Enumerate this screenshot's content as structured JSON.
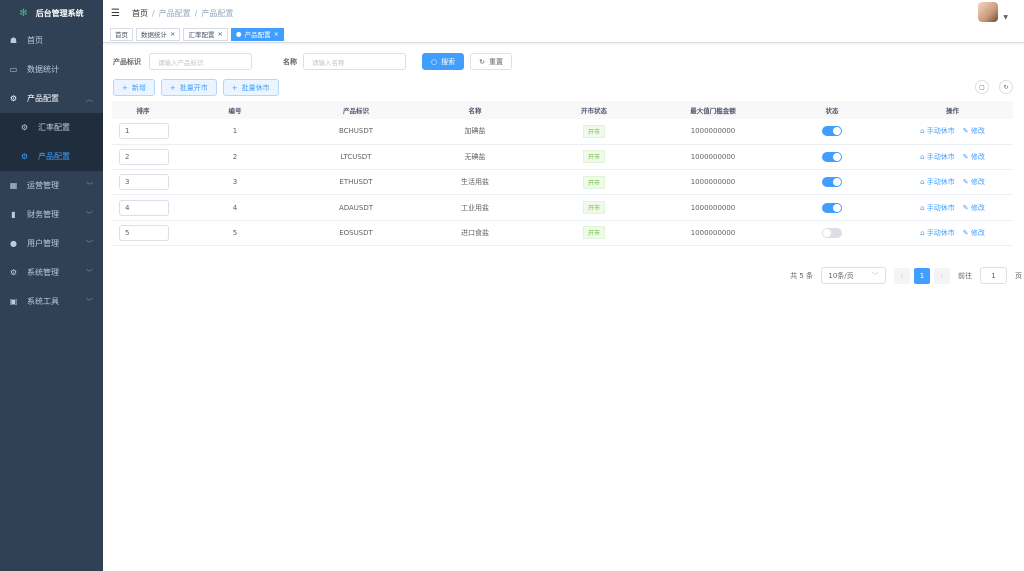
{
  "app": {
    "title": "后台管理系统"
  },
  "sidebar": {
    "items": [
      {
        "label": "首页",
        "icon": "dashboard-icon"
      },
      {
        "label": "数据统计",
        "icon": "monitor-icon"
      },
      {
        "label": "产品配置",
        "icon": "gear-icon",
        "expanded": true,
        "children": [
          {
            "label": "汇率配置"
          },
          {
            "label": "产品配置",
            "active": true
          }
        ]
      },
      {
        "label": "运营管理",
        "icon": "grid-icon"
      },
      {
        "label": "财务管理",
        "icon": "book-icon"
      },
      {
        "label": "用户管理",
        "icon": "user-icon"
      },
      {
        "label": "系统管理",
        "icon": "gear-icon"
      },
      {
        "label": "系统工具",
        "icon": "toolbox-icon"
      }
    ]
  },
  "breadcrumb": [
    "首页",
    "产品配置",
    "产品配置"
  ],
  "tags": [
    {
      "label": "首页"
    },
    {
      "label": "数据统计"
    },
    {
      "label": "汇率配置"
    },
    {
      "label": "产品配置",
      "active": true
    }
  ],
  "search": {
    "product_label": "产品标识",
    "product_placeholder": "请输入产品标识",
    "name_label": "名称",
    "name_placeholder": "请输入名称",
    "search_btn": "搜索",
    "reset_btn": "重置"
  },
  "toolbar": {
    "add": "新增",
    "batch_open": "批量开市",
    "batch_close": "批量休市"
  },
  "table": {
    "headers": [
      "排序",
      "编号",
      "产品标识",
      "名称",
      "开市状态",
      "最大值门槛金额",
      "状态",
      "操作"
    ],
    "rows": [
      {
        "sort": "1",
        "id": "1",
        "symbol": "BCHUSDT",
        "name": "加碘盐",
        "market": "开市",
        "max": "1000000000",
        "enabled": true
      },
      {
        "sort": "2",
        "id": "2",
        "symbol": "LTCUSDT",
        "name": "无碘盐",
        "market": "开市",
        "max": "1000000000",
        "enabled": true
      },
      {
        "sort": "3",
        "id": "3",
        "symbol": "ETHUSDT",
        "name": "生活用盐",
        "market": "开市",
        "max": "1000000000",
        "enabled": true
      },
      {
        "sort": "4",
        "id": "4",
        "symbol": "ADAUSDT",
        "name": "工业用盐",
        "market": "开市",
        "max": "1000000000",
        "enabled": true
      },
      {
        "sort": "5",
        "id": "5",
        "symbol": "EOSUSDT",
        "name": "进口食盐",
        "market": "开市",
        "max": "1000000000",
        "enabled": false
      }
    ],
    "action_close": "手动休市",
    "action_edit": "修改"
  },
  "pagination": {
    "total": "共 5 条",
    "page_size": "10条/页",
    "current": "1",
    "goto_label": "前往",
    "goto_value": "1",
    "page_suffix": "页"
  },
  "colors": {
    "sidebar": "#304156",
    "primary": "#409eff",
    "success": "#67c23a"
  }
}
